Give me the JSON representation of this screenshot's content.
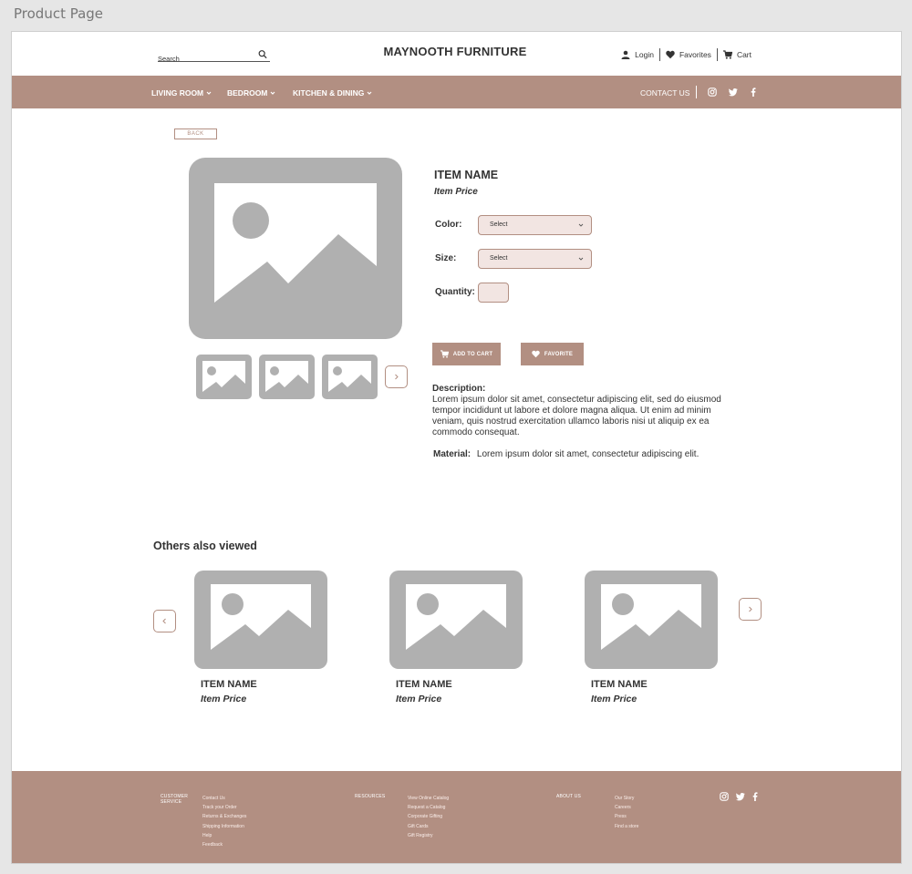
{
  "frame": {
    "title": "Product Page"
  },
  "header": {
    "search_placeholder": "Search",
    "brand": "MAYNOOTH FURNITURE",
    "login": "Login",
    "favorites": "Favorites",
    "cart": "Cart"
  },
  "nav": {
    "categories": [
      "LIVING ROOM",
      "BEDROOM",
      "KITCHEN & DINING"
    ],
    "contact": "CONTACT US",
    "social_icons": [
      "instagram-icon",
      "twitter-icon",
      "facebook-icon"
    ]
  },
  "product": {
    "back_label": "BACK",
    "name": "ITEM NAME",
    "price": "Item Price",
    "color_label": "Color:",
    "color_value": "Select",
    "size_label": "Size:",
    "size_value": "Select",
    "quantity_label": "Quantity:",
    "add_to_cart": "ADD TO CART",
    "favorite": "FAVORITE",
    "description_label": "Description:",
    "description": "Lorem ipsum dolor sit amet, consectetur adipiscing elit, sed do eiusmod tempor incididunt ut labore et dolore magna aliqua. Ut enim ad minim veniam, quis nostrud exercitation ullamco laboris nisi ut aliquip ex ea commodo consequat.",
    "material_label": "Material:",
    "material": "Lorem ipsum dolor sit amet, consectetur adipiscing elit."
  },
  "others": {
    "title": "Others also viewed",
    "items": [
      {
        "name": "ITEM NAME",
        "price": "Item Price"
      },
      {
        "name": "ITEM NAME",
        "price": "Item Price"
      },
      {
        "name": "ITEM NAME",
        "price": "Item Price"
      }
    ]
  },
  "footer": {
    "customer_service": {
      "heading_line1": "CUSTOMER",
      "heading_line2": "SERVICE",
      "links": [
        "Contact Us",
        "Track your Order",
        "Returns & Exchanges",
        "Shipping Information",
        "Help",
        "Feedback"
      ]
    },
    "resources": {
      "heading": "RESOURCES",
      "links": [
        "View Online Catalog",
        "Request a Catalog",
        "Corporate Gifting",
        "Gift Cards",
        "Gift Registry"
      ]
    },
    "about": {
      "heading": "ABOUT US",
      "links": [
        "Our Story",
        "Careers",
        "Press",
        "Find a store"
      ]
    }
  },
  "colors": {
    "accent": "#b28f82",
    "input_fill": "#f2e5e2",
    "placeholder": "#b0b0b0"
  }
}
